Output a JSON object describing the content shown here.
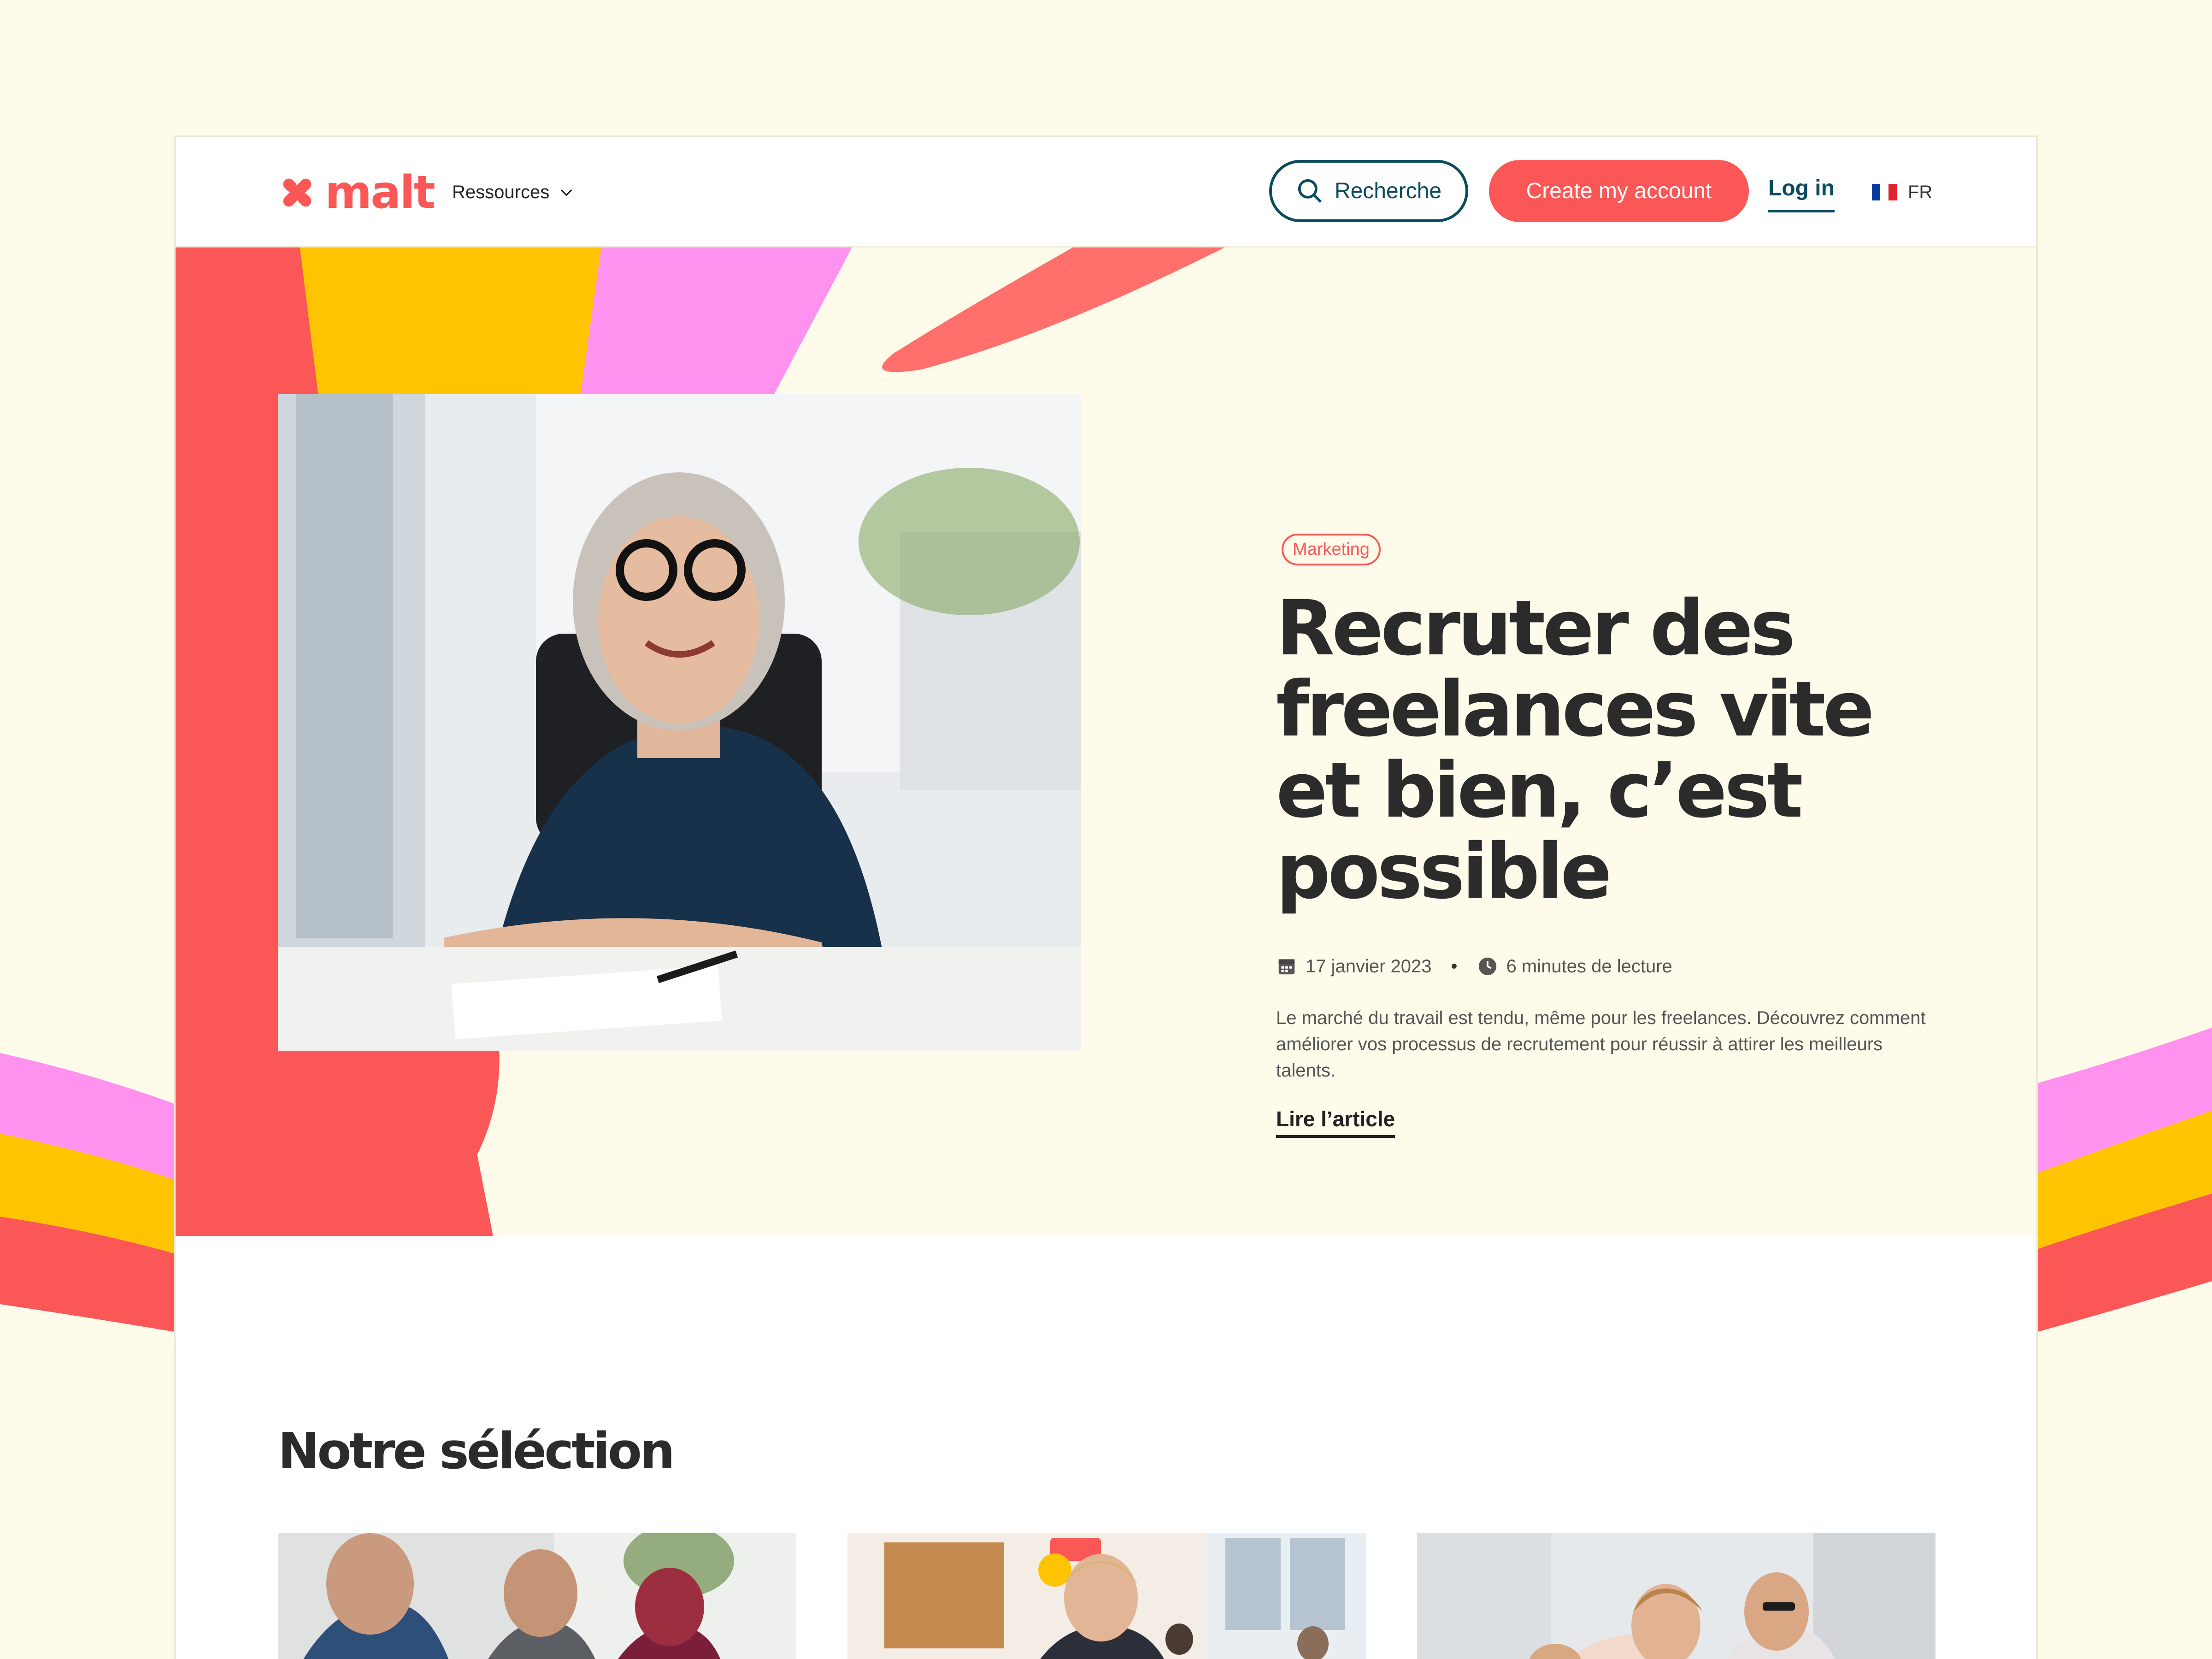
{
  "colors": {
    "brand": "#fc5757",
    "teal": "#0b4b5e",
    "yellow": "#ffc400",
    "pink": "#ff92ee",
    "cream": "#fefbea"
  },
  "header": {
    "logo_text": "malt",
    "logo_icon": "malt-logo-icon",
    "nav_resources": "Ressources",
    "search_label": "Recherche",
    "create_label": "Create my account",
    "login_label": "Log in",
    "lang_label": "FR",
    "lang_flag_icon": "france-flag-icon"
  },
  "hero": {
    "tag": "Marketing",
    "title": "Recruter des freelances vite et bien, c’est possible",
    "date": "17 janvier 2023",
    "read_time": "6 minutes de lecture",
    "description": "Le marché du travail est tendu, même pour les freelances. Découvrez comment améliorer vos processus de recrutement pour réussir à attirer les meilleurs talents.",
    "cta": "Lire l’article"
  },
  "selection": {
    "title": "Notre séléction",
    "cards": [
      {
        "photo": "photo-team-meeting"
      },
      {
        "photo": "photo-office-woman"
      },
      {
        "photo": "photo-colleagues-laptop"
      }
    ]
  }
}
